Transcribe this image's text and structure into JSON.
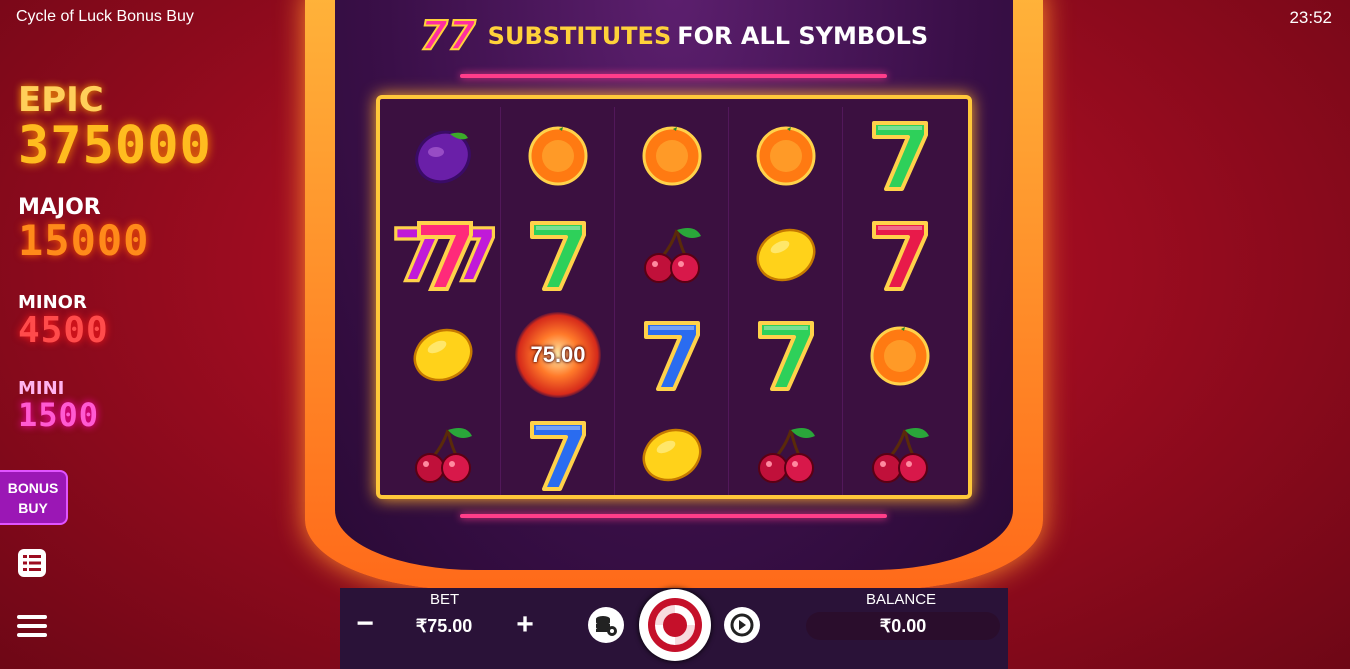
{
  "app": {
    "title": "Cycle of Luck Bonus Buy",
    "clock": "23:52"
  },
  "jackpots": {
    "epic": {
      "label": "EPIC",
      "value": "375000"
    },
    "major": {
      "label": "MAJOR",
      "value": "15000"
    },
    "minor": {
      "label": "MINOR",
      "value": "4500"
    },
    "mini": {
      "label": "MINI",
      "value": "1500"
    }
  },
  "sidebar": {
    "bonus_buy": "BONUS BUY",
    "paytable_icon": "list-icon",
    "menu_icon": "hamburger-icon"
  },
  "banner": {
    "symbol": "77",
    "highlight": "SUBSTITUTES",
    "rest": "FOR ALL SYMBOLS"
  },
  "reels": [
    [
      "plum",
      "seven-purple-wild",
      "lemon",
      "cherry"
    ],
    [
      "orange",
      "seven-green",
      "cash-75",
      "seven-blue"
    ],
    [
      "orange",
      "cherry",
      "seven-blue",
      "lemon"
    ],
    [
      "orange",
      "lemon",
      "seven-green",
      "cherry"
    ],
    [
      "seven-green",
      "seven-red",
      "orange",
      "cherry"
    ]
  ],
  "cash_symbol": {
    "value": "75.00"
  },
  "controls": {
    "bet_label": "BET",
    "bet_value": "₹75.00",
    "minus": "−",
    "plus": "+",
    "balance_label": "BALANCE",
    "balance_value": "₹0.00",
    "bet_settings_icon": "coins-gear-icon",
    "spin_icon": "spin-icon",
    "autoplay_icon": "autoplay-icon"
  },
  "colors": {
    "accent": "#ffc83a",
    "background": "#9c0c20",
    "neon": "#ff3d8b"
  }
}
